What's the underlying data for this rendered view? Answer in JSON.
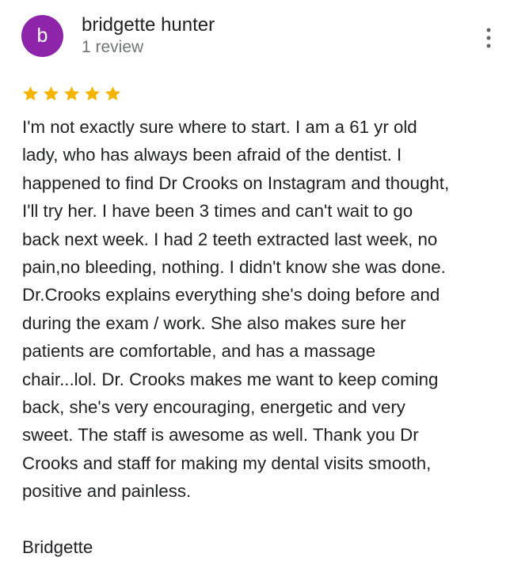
{
  "reviewer": {
    "initial": "b",
    "name": "bridgette hunter",
    "review_count": "1 review",
    "avatar_color": "#8e24aa"
  },
  "actions": {
    "more_icon": "more-vertical-icon"
  },
  "rating": {
    "value": 5,
    "max": 5,
    "star_color": "#f4b400",
    "star_icon": "star-icon"
  },
  "review": {
    "text": "I'm not exactly sure where to start. I am a 61 yr old\nlady, who has always been afraid of the dentist. I\nhappened to find Dr Crooks on Instagram and thought,\nI'll try her. I have been 3 times and can't wait to go\nback next week. I had 2 teeth extracted last week, no\npain,no bleeding, nothing. I didn't know she was done.\nDr.Crooks explains everything she's doing before and\nduring the exam / work. She also makes sure her\npatients are comfortable, and has a massage\nchair...lol. Dr. Crooks makes me want to keep coming\nback, she's very encouraging, energetic and very\nsweet. The staff is awesome as well. Thank you Dr\nCrooks and staff for making my dental visits smooth,\npositive and painless.\n\nBridgette"
  }
}
